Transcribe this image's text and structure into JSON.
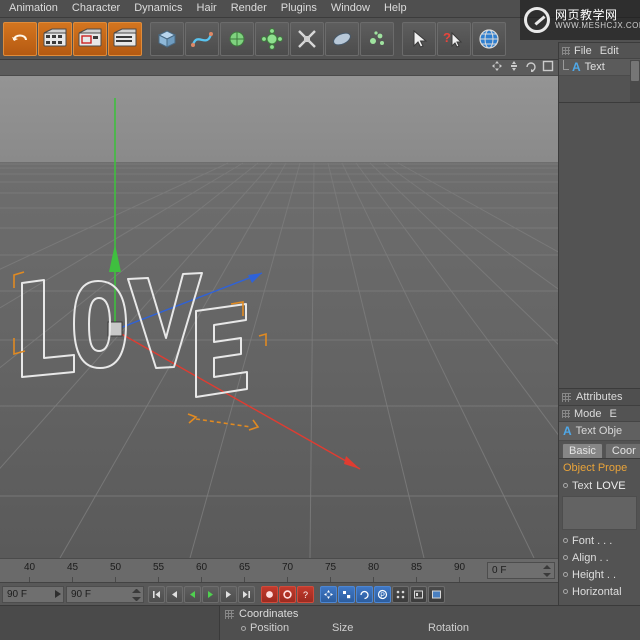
{
  "app": {
    "title": "Cinema 4D",
    "menus": [
      {
        "label": "Animation"
      },
      {
        "label": "Character"
      },
      {
        "label": "Dynamics"
      },
      {
        "label": "Hair"
      },
      {
        "label": "Render"
      },
      {
        "label": "Plugins"
      },
      {
        "label": "Window"
      },
      {
        "label": "Help"
      }
    ]
  },
  "watermark": {
    "main": "网页教学网",
    "sub": "WWW.MESHCJX.COM"
  },
  "toolbar": {
    "buttons": [
      {
        "name": "undo-icon",
        "label": "Undo",
        "selected": false
      },
      {
        "name": "render-view-icon",
        "label": "Render View",
        "selected": true
      },
      {
        "name": "render-region-icon",
        "label": "Render Region",
        "selected": false
      },
      {
        "name": "render-settings-icon",
        "label": "Render Settings",
        "selected": false
      },
      {
        "name": "cube-primitive-icon",
        "label": "Cube",
        "selected": false
      },
      {
        "name": "spline-icon",
        "label": "Spline",
        "selected": false
      },
      {
        "name": "generator-icon",
        "label": "Generators",
        "selected": false
      },
      {
        "name": "deformer-icon",
        "label": "Deformers",
        "selected": false
      },
      {
        "name": "scene-object-icon",
        "label": "Scene",
        "selected": false
      },
      {
        "name": "camera-icon",
        "label": "Camera",
        "selected": false
      },
      {
        "name": "light-icon",
        "label": "Light",
        "selected": false
      },
      {
        "name": "pointer-icon",
        "label": "Select",
        "selected": false
      },
      {
        "name": "help-cursor-icon",
        "label": "Context Help",
        "selected": false
      },
      {
        "name": "globe-icon",
        "label": "Web",
        "selected": false
      }
    ]
  },
  "viewport": {
    "header_icons": [
      {
        "name": "move-view-icon"
      },
      {
        "name": "scale-view-icon"
      },
      {
        "name": "rotate-view-icon"
      },
      {
        "name": "maximize-view-icon"
      }
    ],
    "scene_text": "LOVE",
    "axis": {
      "x_color": "#e03c31",
      "y_color": "#3fbf3f",
      "z_color": "#2f62d8"
    },
    "selection_color": "#e08a22"
  },
  "timeline": {
    "ticks": [
      "40",
      "45",
      "50",
      "55",
      "60",
      "65",
      "70",
      "75",
      "80",
      "85",
      "90"
    ],
    "current_field": "0 F"
  },
  "transport": {
    "frame_field": "90 F",
    "end_field": "90 F",
    "buttons": [
      {
        "name": "go-to-start-button",
        "glyph": "start"
      },
      {
        "name": "step-back-button",
        "glyph": "prev"
      },
      {
        "name": "play-reverse-button",
        "glyph": "rev"
      },
      {
        "name": "play-forward-button",
        "glyph": "play"
      },
      {
        "name": "step-forward-button",
        "glyph": "next"
      },
      {
        "name": "go-to-end-button",
        "glyph": "end"
      },
      {
        "name": "record-active-objects-button",
        "glyph": "rec"
      },
      {
        "name": "autokeying-button",
        "glyph": "rec2"
      },
      {
        "name": "keyframe-selection-button",
        "glyph": "quest"
      },
      {
        "name": "position-key-button",
        "glyph": "pos"
      },
      {
        "name": "scale-key-button",
        "glyph": "scl"
      },
      {
        "name": "rotation-key-button",
        "glyph": "rot"
      },
      {
        "name": "parameter-key-button",
        "glyph": "param"
      },
      {
        "name": "point-level-animation-button",
        "glyph": "pla"
      },
      {
        "name": "timeline-button",
        "glyph": "tl"
      },
      {
        "name": "open-timeline-button",
        "glyph": "tl2"
      }
    ]
  },
  "coordinates": {
    "title": "Coordinates",
    "columns": [
      "Position",
      "Size",
      "Rotation"
    ]
  },
  "object_manager": {
    "title": "",
    "menus": [
      "File",
      "Edit"
    ],
    "objects": [
      {
        "icon": "text-object-icon",
        "name": "Text"
      }
    ]
  },
  "attributes": {
    "title": "Attributes",
    "menus": [
      "Mode",
      "E"
    ],
    "object_label": "Text Obje",
    "tabs": [
      {
        "label": "Basic",
        "active": true
      },
      {
        "label": "Coor",
        "active": false
      }
    ],
    "section": "Object Prope",
    "properties": [
      {
        "label": "Text",
        "value": "LOVE"
      },
      {
        "label": "Font . . .",
        "value": ""
      },
      {
        "label": "Align . .",
        "value": ""
      },
      {
        "label": "Height . .",
        "value": ""
      },
      {
        "label": "Horizontal",
        "value": ""
      }
    ]
  }
}
